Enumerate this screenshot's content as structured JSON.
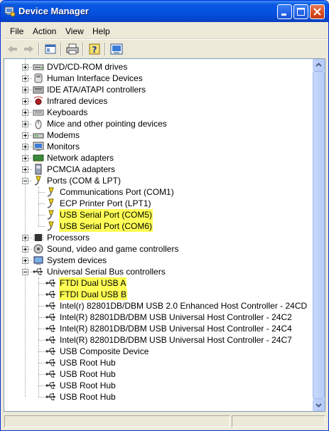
{
  "window": {
    "title": "Device Manager",
    "title_icon": "device-manager-icon"
  },
  "title_buttons": [
    {
      "name": "minimize-button",
      "icon": "minimize-icon"
    },
    {
      "name": "maximize-button",
      "icon": "maximize-icon"
    },
    {
      "name": "close-button",
      "icon": "close-icon"
    }
  ],
  "menu": [
    "File",
    "Action",
    "View",
    "Help"
  ],
  "toolbar": [
    "back-arrow-icon",
    "forward-arrow-icon",
    "show-hide-console-tree-icon",
    "print-icon",
    "help-icon",
    "properties-icon"
  ],
  "colors": {
    "highlight": "#ffff55",
    "titlebar": "#0454e2",
    "close": "#d8481c"
  },
  "tree": {
    "categories": [
      {
        "label": "DVD/CD-ROM drives",
        "icon": "dvd-drive-icon",
        "expanded": false,
        "children": []
      },
      {
        "label": "Human Interface Devices",
        "icon": "hid-icon",
        "expanded": false,
        "children": []
      },
      {
        "label": "IDE ATA/ATAPI controllers",
        "icon": "ide-controller-icon",
        "expanded": false,
        "children": []
      },
      {
        "label": "Infrared devices",
        "icon": "infrared-icon",
        "expanded": false,
        "children": []
      },
      {
        "label": "Keyboards",
        "icon": "keyboard-icon",
        "expanded": false,
        "children": []
      },
      {
        "label": "Mice and other pointing devices",
        "icon": "mouse-icon",
        "expanded": false,
        "children": []
      },
      {
        "label": "Modems",
        "icon": "modem-icon",
        "expanded": false,
        "children": []
      },
      {
        "label": "Monitors",
        "icon": "monitor-icon",
        "expanded": false,
        "children": []
      },
      {
        "label": "Network adapters",
        "icon": "network-adapter-icon",
        "expanded": false,
        "children": []
      },
      {
        "label": "PCMCIA adapters",
        "icon": "pcmcia-icon",
        "expanded": false,
        "children": []
      },
      {
        "label": "Ports (COM & LPT)",
        "icon": "port-icon",
        "expanded": true,
        "children": [
          {
            "label": "Communications Port (COM1)",
            "icon": "port-icon",
            "highlight": false
          },
          {
            "label": "ECP Printer Port (LPT1)",
            "icon": "port-icon",
            "highlight": false
          },
          {
            "label": "USB Serial Port (COM5)",
            "icon": "port-icon",
            "highlight": true
          },
          {
            "label": "USB Serial Port (COM6)",
            "icon": "port-icon",
            "highlight": true
          }
        ]
      },
      {
        "label": "Processors",
        "icon": "processor-icon",
        "expanded": false,
        "children": []
      },
      {
        "label": "Sound, video and game controllers",
        "icon": "sound-icon",
        "expanded": false,
        "children": []
      },
      {
        "label": "System devices",
        "icon": "system-devices-icon",
        "expanded": false,
        "children": []
      },
      {
        "label": "Universal Serial Bus controllers",
        "icon": "usb-icon",
        "expanded": true,
        "children": [
          {
            "label": "FTDI Dual USB A",
            "icon": "usb-icon",
            "highlight": true
          },
          {
            "label": "FTDI Dual USB B",
            "icon": "usb-icon",
            "highlight": true
          },
          {
            "label": "Intel(r) 82801DB/DBM USB 2.0 Enhanced Host Controller - 24CD",
            "icon": "usb-icon",
            "highlight": false
          },
          {
            "label": "Intel(R) 82801DB/DBM USB Universal Host Controller - 24C2",
            "icon": "usb-icon",
            "highlight": false
          },
          {
            "label": "Intel(R) 82801DB/DBM USB Universal Host Controller - 24C4",
            "icon": "usb-icon",
            "highlight": false
          },
          {
            "label": "Intel(R) 82801DB/DBM USB Universal Host Controller - 24C7",
            "icon": "usb-icon",
            "highlight": false
          },
          {
            "label": "USB Composite Device",
            "icon": "usb-icon",
            "highlight": false
          },
          {
            "label": "USB Root Hub",
            "icon": "usb-icon",
            "highlight": false
          },
          {
            "label": "USB Root Hub",
            "icon": "usb-icon",
            "highlight": false
          },
          {
            "label": "USB Root Hub",
            "icon": "usb-icon",
            "highlight": false
          },
          {
            "label": "USB Root Hub",
            "icon": "usb-icon",
            "highlight": false
          }
        ]
      }
    ]
  }
}
